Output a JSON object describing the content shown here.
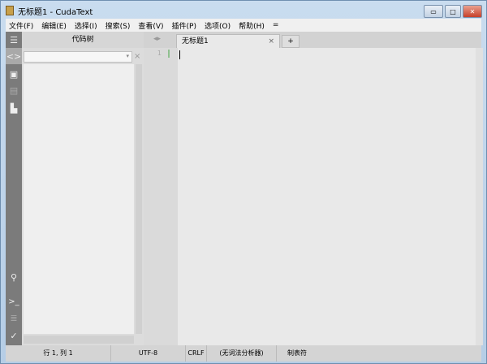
{
  "window": {
    "title": "无标题1 - CudaText",
    "min": "▭",
    "max": "□",
    "close": "✕"
  },
  "menu": [
    "文件(F)",
    "编辑(E)",
    "选择(I)",
    "搜索(S)",
    "查看(V)",
    "插件(P)",
    "选项(O)",
    "帮助(H)",
    "="
  ],
  "panel": {
    "title": "代码树",
    "close": "×",
    "dropdown": "▾"
  },
  "tabs": {
    "nav": "◂▸",
    "items": [
      {
        "label": "无标题1",
        "close": "×"
      }
    ],
    "add": "+"
  },
  "editor": {
    "line_numbers": [
      "1"
    ]
  },
  "status": {
    "position": "行 1, 列 1",
    "encoding": "UTF-8",
    "line_ending": "CRLF",
    "lexer": "(无词法分析器)",
    "tabs": "制表符"
  },
  "sidebar_icons": [
    "menu-icon",
    "code-tree-icon",
    "project-icon",
    "tabs-list-icon",
    "snippets-icon",
    "search-icon",
    "console-icon",
    "output-icon",
    "validate-icon"
  ]
}
